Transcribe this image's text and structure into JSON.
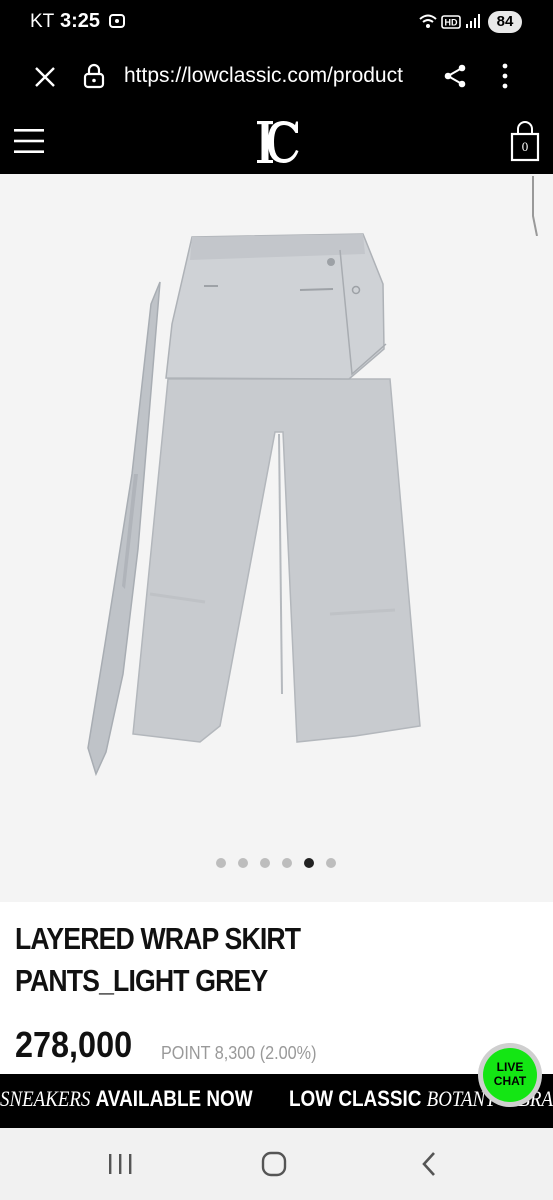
{
  "status_bar": {
    "carrier": "KT",
    "time": "3:25",
    "battery": "84"
  },
  "browser": {
    "url": "https://lowclassic.com/product"
  },
  "site": {
    "logo_text": "LC",
    "cart_count": "0"
  },
  "gallery": {
    "image_count": 6,
    "active_index": 4
  },
  "product": {
    "title_line1": "LAYERED WRAP SKIRT",
    "title_line2": "PANTS_LIGHT GREY",
    "price": "278,000",
    "point": "POINT 8,300 (2.00%)"
  },
  "live_chat": {
    "line1": "LIVE",
    "line2": "CHAT",
    "color": "#14e614"
  },
  "marquee": {
    "seg1_italic": "SNEAKERS",
    "seg1_bold": "AVAILABLE NOW",
    "seg2_bold": "LOW CLASSIC",
    "seg2_italic": "BOTANY VIBRA"
  },
  "icons": [
    "close-icon",
    "lock-icon",
    "share-icon",
    "more-icon",
    "menu-icon",
    "shopping-bag-icon",
    "recent-apps-icon",
    "home-icon",
    "back-icon"
  ]
}
